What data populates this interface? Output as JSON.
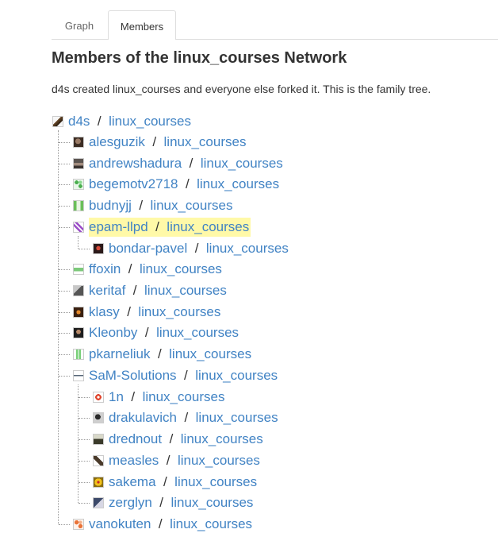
{
  "tabs": [
    {
      "label": "Graph",
      "selected": false
    },
    {
      "label": "Members",
      "selected": true
    }
  ],
  "header": {
    "title": "Members of the linux_courses Network",
    "description": "d4s created linux_courses and everyone else forked it. This is the family tree."
  },
  "separator": "/",
  "tree": {
    "root": {
      "user": "d4s",
      "repo": "linux_courses",
      "avatar_icon": "user-avatar-icon"
    },
    "nodes": [
      {
        "user": "alesguzik",
        "repo": "linux_courses"
      },
      {
        "user": "andrewshadura",
        "repo": "linux_courses"
      },
      {
        "user": "begemotv2718",
        "repo": "linux_courses"
      },
      {
        "user": "budnyjj",
        "repo": "linux_courses"
      },
      {
        "user": "epam-llpd",
        "repo": "linux_courses",
        "highlighted": true
      },
      {
        "user": "bondar-pavel",
        "repo": "linux_courses"
      },
      {
        "user": "ffoxin",
        "repo": "linux_courses"
      },
      {
        "user": "keritaf",
        "repo": "linux_courses"
      },
      {
        "user": "klasy",
        "repo": "linux_courses"
      },
      {
        "user": "Kleonby",
        "repo": "linux_courses"
      },
      {
        "user": "pkarneliuk",
        "repo": "linux_courses"
      },
      {
        "user": "SaM-Solutions",
        "repo": "linux_courses"
      },
      {
        "user": "1n",
        "repo": "linux_courses"
      },
      {
        "user": "drakulavich",
        "repo": "linux_courses"
      },
      {
        "user": "drednout",
        "repo": "linux_courses"
      },
      {
        "user": "measles",
        "repo": "linux_courses"
      },
      {
        "user": "sakema",
        "repo": "linux_courses"
      },
      {
        "user": "zerglyn",
        "repo": "linux_courses"
      },
      {
        "user": "vanokuten",
        "repo": "linux_courses"
      }
    ]
  },
  "colors": {
    "link": "#4183c4",
    "highlight": "#fff9a8",
    "text": "#333333"
  }
}
